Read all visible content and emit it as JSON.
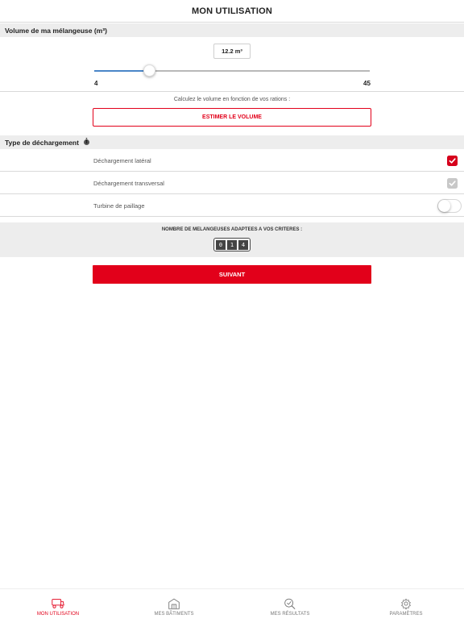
{
  "header": {
    "title": "MON UTILISATION"
  },
  "volume": {
    "section_title": "Volume de ma mélangeuse (m³)",
    "value_label": "12.2 m³",
    "slider_value": 12.2,
    "min_label": "4",
    "max_label": "45",
    "min": 4,
    "max": 45
  },
  "estimate": {
    "hint": "Calculez le volume en fonction de vos rations :",
    "button_label": "ESTIMER LE VOLUME"
  },
  "unloading": {
    "section_title": "Type de déchargement",
    "info_glyph": "i",
    "options": [
      {
        "label": "Déchargement latéral",
        "control": "checkbox",
        "checked": true
      },
      {
        "label": "Déchargement transversal",
        "control": "checkbox",
        "checked": false
      },
      {
        "label": "Turbine de paillage",
        "control": "toggle",
        "checked": false
      }
    ]
  },
  "counter": {
    "title": "NOMBRE DE MELANGEUSES ADAPTEES A VOS CRITERES :",
    "digits": [
      "0",
      "1",
      "4"
    ]
  },
  "next": {
    "button_label": "SUIVANT"
  },
  "tabs": [
    {
      "label": "MON UTILISATION",
      "icon": "mixer-truck-icon",
      "active": true
    },
    {
      "label": "MES BÂTIMENTS",
      "icon": "barn-icon",
      "active": false
    },
    {
      "label": "MES RÉSULTATS",
      "icon": "search-check-icon",
      "active": false
    },
    {
      "label": "PARAMÈTRES",
      "icon": "gear-icon",
      "active": false
    }
  ],
  "colors": {
    "accent": "#e2001a",
    "slider_fill": "#4a86c8",
    "section_bg": "#ededed"
  }
}
